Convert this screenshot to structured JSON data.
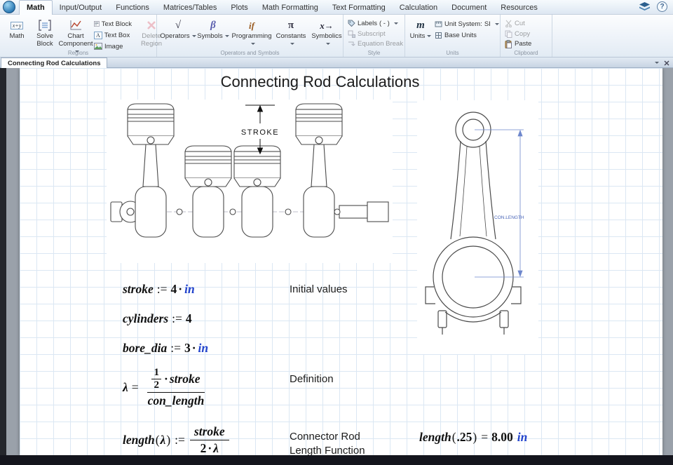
{
  "titlebar": {
    "tabs": [
      "Math",
      "Input/Output",
      "Functions",
      "Matrices/Tables",
      "Plots",
      "Math Formatting",
      "Text Formatting",
      "Calculation",
      "Document",
      "Resources"
    ],
    "help": "?"
  },
  "ribbon": {
    "regions": {
      "label": "Regions",
      "math": "Math",
      "solve_block": "Solve\nBlock",
      "chart_component": "Chart\nComponent",
      "text_block": "Text Block",
      "text_box": "Text Box",
      "image": "Image",
      "delete_region": "Delete\nRegion"
    },
    "operators_symbols": {
      "label": "Operators and Symbols",
      "operators": "Operators",
      "symbols": "Symbols",
      "programming": "Programming",
      "constants": "Constants",
      "symbolics": "Symbolics"
    },
    "style": {
      "label": "Style",
      "labels": "Labels",
      "labels_value": "( - )",
      "subscript": "Subscript",
      "equation_break": "Equation Break"
    },
    "units": {
      "label": "Units",
      "units": "Units",
      "unit_system": "Unit System:",
      "unit_system_value": "SI",
      "base_units": "Base Units"
    },
    "clipboard": {
      "label": "Clipboard",
      "cut": "Cut",
      "copy": "Copy",
      "paste": "Paste"
    },
    "icons": {
      "math": "x+y",
      "text_box": "A",
      "operators": "√",
      "symbols": "β",
      "programming": "if",
      "constants": "π",
      "symbolics": "x→",
      "units": "m"
    }
  },
  "doctab": {
    "title": "Connecting Rod Calculations"
  },
  "page": {
    "title": "Connecting Rod Calculations",
    "drawings": {
      "stroke_label": "STROKE",
      "con_length_label": "CON.LENGTH"
    },
    "annotations": {
      "initial_values": "Initial values",
      "definition": "Definition",
      "length_function": "Connector Rod\nLength Function"
    },
    "math": {
      "stroke_def": {
        "name": "stroke",
        "op": ":=",
        "value": "4",
        "dot": "·",
        "unit": "in"
      },
      "cylinders_def": {
        "name": "cylinders",
        "op": ":=",
        "value": "4"
      },
      "bore_def": {
        "name": "bore_dia",
        "op": ":=",
        "value": "3",
        "dot": "·",
        "unit": "in"
      },
      "lambda_def": {
        "name": "λ",
        "op": "=",
        "half_num": "1",
        "half_den": "2",
        "dot": "·",
        "num_var": "stroke",
        "den_var": "con_length"
      },
      "length_def": {
        "name": "length",
        "lparen": "(",
        "arg": "λ",
        "rparen": ")",
        "op": ":=",
        "num_var": "stroke",
        "den_coef": "2",
        "dot": "·",
        "den_var": "λ"
      },
      "length_eval": {
        "name": "length",
        "lparen": "(",
        "arg": ".25",
        "rparen": ")",
        "op": "=",
        "result": "8.00",
        "unit": "in"
      }
    }
  }
}
